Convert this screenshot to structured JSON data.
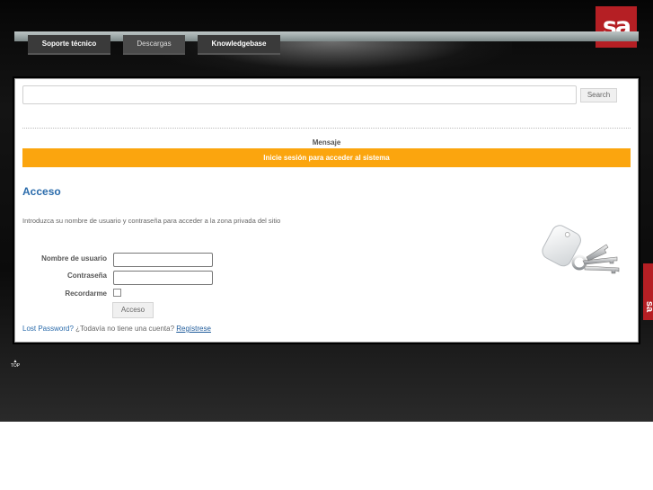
{
  "brand": {
    "logo_text": "sa",
    "color": "#b51f24"
  },
  "nav": {
    "items": [
      {
        "label": "Soporte técnico",
        "style": "bold"
      },
      {
        "label": "Descargas",
        "style": "plain"
      },
      {
        "label": "Knowledgebase",
        "style": "bold"
      }
    ]
  },
  "search": {
    "value": "",
    "button": "Search"
  },
  "message": {
    "heading": "Mensaje",
    "text": "Inicie sesión para acceder al sistema",
    "color": "#fba50e"
  },
  "login": {
    "title": "Acceso",
    "intro": "Introduzca su nombre de usuario y contraseña para acceder a la zona privada del sitio",
    "username_label": "Nombre de usuario",
    "password_label": "Contraseña",
    "remember_label": "Recordarme",
    "remember_checked": false,
    "submit": "Acceso",
    "lost_password": "Lost Password?",
    "no_account": "¿Todavía no tiene una cuenta?",
    "register": "Regístrese"
  },
  "footer": {
    "top_link": "TOP"
  },
  "side_tab": {
    "text": "sa"
  }
}
